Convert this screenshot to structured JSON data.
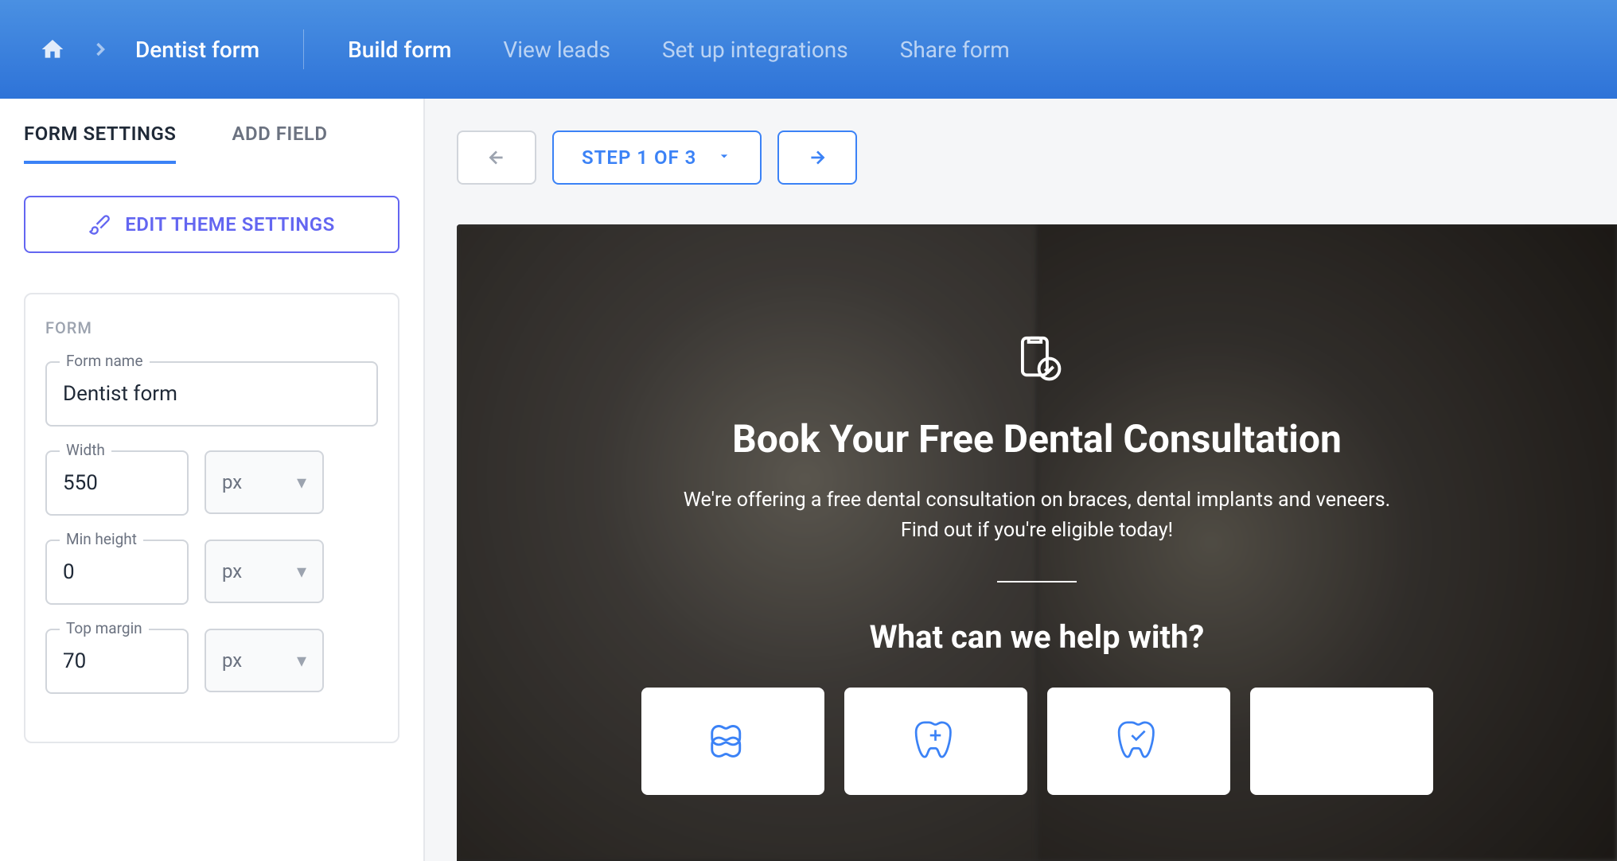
{
  "header": {
    "breadcrumb_title": "Dentist form",
    "nav": [
      {
        "label": "Build form",
        "active": true
      },
      {
        "label": "View leads",
        "active": false
      },
      {
        "label": "Set up integrations",
        "active": false
      },
      {
        "label": "Share form",
        "active": false
      }
    ]
  },
  "sidebar": {
    "tabs": [
      {
        "label": "FORM SETTINGS",
        "active": true
      },
      {
        "label": "ADD FIELD",
        "active": false
      }
    ],
    "theme_button": "EDIT THEME SETTINGS",
    "section_title": "FORM",
    "fields": {
      "form_name": {
        "label": "Form name",
        "value": "Dentist form"
      },
      "width": {
        "label": "Width",
        "value": "550",
        "unit": "px"
      },
      "min_height": {
        "label": "Min height",
        "value": "0",
        "unit": "px"
      },
      "top_margin": {
        "label": "Top margin",
        "value": "70",
        "unit": "px"
      }
    }
  },
  "stepper": {
    "label": "STEP 1 OF 3"
  },
  "preview": {
    "title": "Book Your Free Dental Consultation",
    "subtitle": "We're offering a free dental consultation on braces, dental implants and veneers. Find out if you're eligible today!",
    "question": "What can we help with?"
  }
}
